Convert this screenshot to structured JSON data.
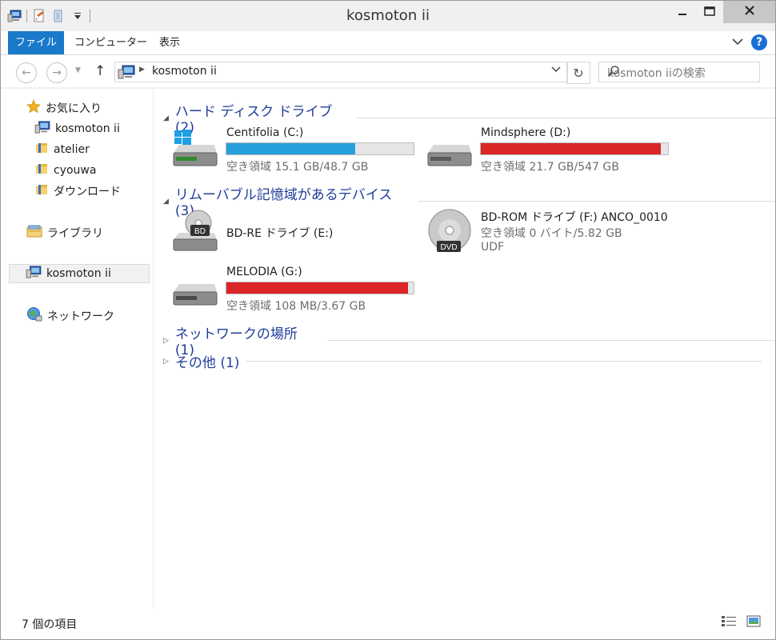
{
  "window": {
    "title": "kosmoton ii"
  },
  "ribbon": {
    "tabs": [
      "ファイル",
      "コンピューター",
      "表示"
    ]
  },
  "address": {
    "path": "kosmoton ii",
    "search_placeholder": "kosmoton iiの検索"
  },
  "nav": {
    "favorites_label": "お気に入り",
    "favorites": [
      "kosmoton ii",
      "atelier",
      "cyouwa",
      "ダウンロード"
    ],
    "libraries_label": "ライブラリ",
    "computer_label": "kosmoton ii",
    "network_label": "ネットワーク"
  },
  "groups": {
    "hdd": {
      "header": "ハード ディスク ドライブ (2)",
      "drives": [
        {
          "name": "Centifolia (C:)",
          "free": "空き領域 15.1 GB/48.7 GB",
          "used_pct": 69,
          "color": "#26a0da"
        },
        {
          "name": "Mindsphere (D:)",
          "free": "空き領域 21.7 GB/547 GB",
          "used_pct": 96,
          "color": "#da2626"
        }
      ]
    },
    "removable": {
      "header": "リムーバブル記憶域があるデバイス (3)",
      "bdre": {
        "name": "BD-RE ドライブ (E:)",
        "badge": "BD"
      },
      "bdrom": {
        "name": "BD-ROM ドライブ (F:) ANCO_0010",
        "free": "空き領域 0 バイト/5.82 GB",
        "fs": "UDF",
        "badge": "DVD"
      },
      "melodia": {
        "name": "MELODIA (G:)",
        "free": "空き領域 108 MB/3.67 GB",
        "used_pct": 97,
        "color": "#da2626"
      }
    },
    "network": {
      "header": "ネットワークの場所 (1)"
    },
    "other": {
      "header": "その他 (1)"
    }
  },
  "status": {
    "count": "7 個の項目"
  }
}
